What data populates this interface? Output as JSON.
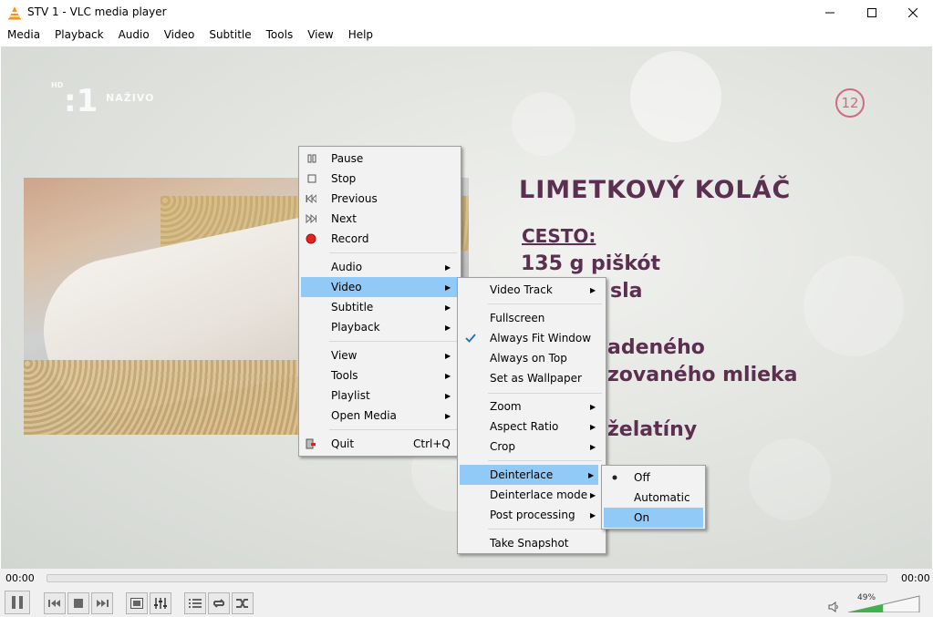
{
  "window": {
    "title": "STV 1 - VLC media player"
  },
  "menubar": [
    "Media",
    "Playback",
    "Audio",
    "Video",
    "Subtitle",
    "Tools",
    "View",
    "Help"
  ],
  "overlay": {
    "logo_hd": "HD",
    "logo_channel": ":1",
    "logo_live": "NAŽIVO",
    "age_rating": "12",
    "recipe_lines": [
      "LIMETKOVÝ KOLÁČ",
      "CESTO:",
      "135 g piškót",
      "sla",
      "adeného",
      "zovaného mlieka",
      "želatíny"
    ]
  },
  "context_menu": {
    "items": [
      {
        "icon": "pause-icon",
        "label": "Pause"
      },
      {
        "icon": "stop-icon",
        "label": "Stop"
      },
      {
        "icon": "previous-icon",
        "label": "Previous"
      },
      {
        "icon": "next-icon",
        "label": "Next"
      },
      {
        "icon": "record-icon",
        "label": "Record"
      },
      {
        "label": "Audio"
      },
      {
        "label": "Video"
      },
      {
        "label": "Subtitle"
      },
      {
        "label": "Playback"
      },
      {
        "label": "View"
      },
      {
        "label": "Tools"
      },
      {
        "label": "Playlist"
      },
      {
        "label": "Open Media"
      },
      {
        "icon": "quit-icon",
        "label": "Quit",
        "shortcut": "Ctrl+Q"
      }
    ]
  },
  "video_menu": {
    "items": [
      {
        "label": "Video Track"
      },
      {
        "label": "Fullscreen"
      },
      {
        "label": "Always Fit Window",
        "checked": true
      },
      {
        "label": "Always on Top"
      },
      {
        "label": "Set as Wallpaper"
      },
      {
        "label": "Zoom"
      },
      {
        "label": "Aspect Ratio"
      },
      {
        "label": "Crop"
      },
      {
        "label": "Deinterlace"
      },
      {
        "label": "Deinterlace mode"
      },
      {
        "label": "Post processing"
      },
      {
        "label": "Take Snapshot"
      }
    ]
  },
  "deinterlace_menu": {
    "items": [
      {
        "label": "Off",
        "selected": true
      },
      {
        "label": "Automatic"
      },
      {
        "label": "On"
      }
    ]
  },
  "player": {
    "time_elapsed": "00:00",
    "time_total": "00:00",
    "volume": "49%",
    "volume_fraction": 0.49
  },
  "colors": {
    "highlight": "#91c9f7",
    "recipe_text": "#5a2f4f",
    "volume_fill": "#3ab54a"
  }
}
